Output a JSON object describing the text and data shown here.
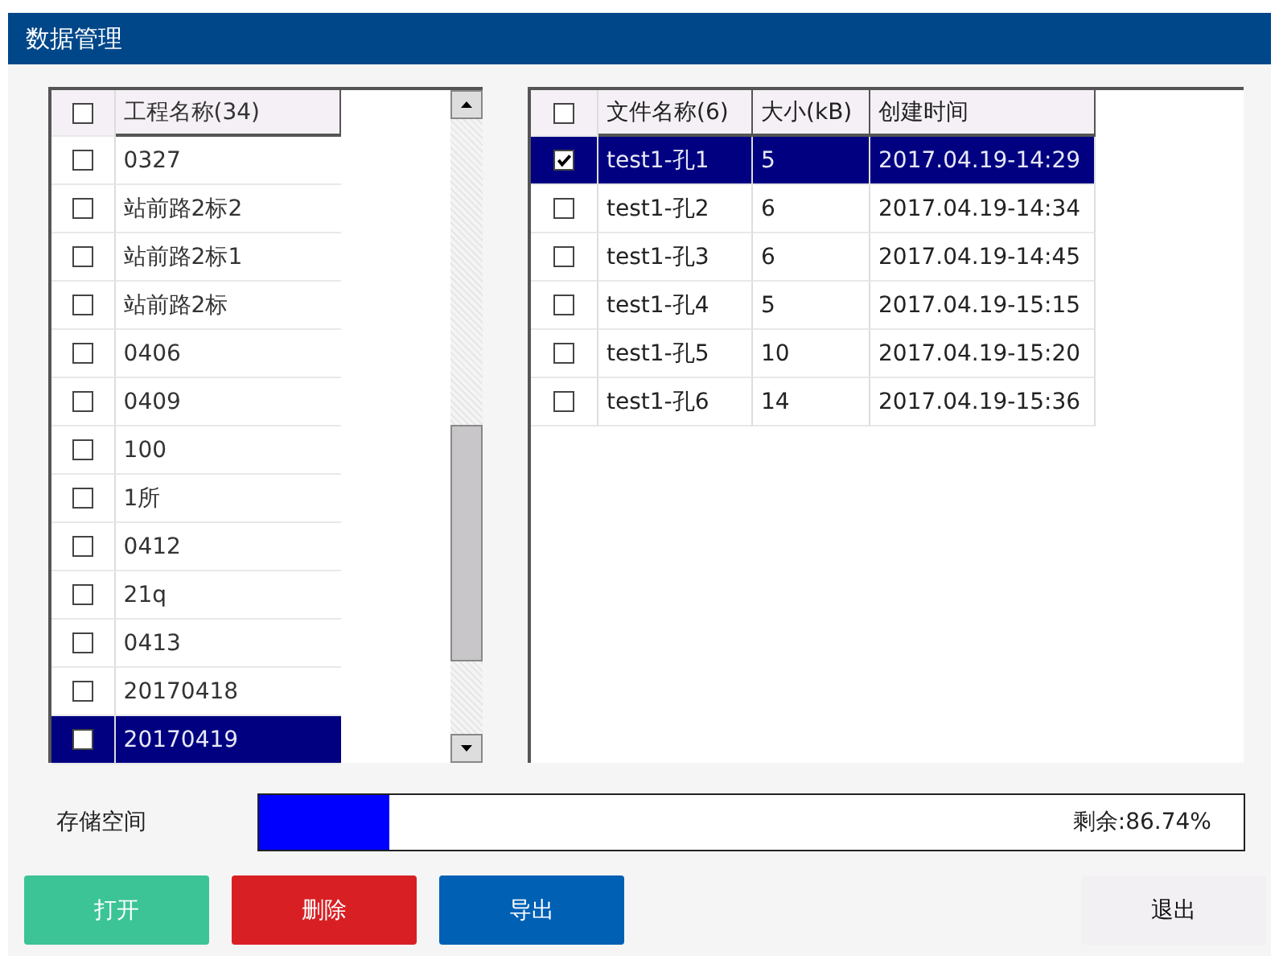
{
  "window": {
    "title": "数据管理"
  },
  "projects": {
    "header": "工程名称(34)",
    "header_checked": false,
    "rows": [
      {
        "name": "0327",
        "checked": false,
        "selected": false
      },
      {
        "name": "站前路2标2",
        "checked": false,
        "selected": false
      },
      {
        "name": "站前路2标1",
        "checked": false,
        "selected": false
      },
      {
        "name": "站前路2标",
        "checked": false,
        "selected": false
      },
      {
        "name": "0406",
        "checked": false,
        "selected": false
      },
      {
        "name": "0409",
        "checked": false,
        "selected": false
      },
      {
        "name": "100",
        "checked": false,
        "selected": false
      },
      {
        "name": "1所",
        "checked": false,
        "selected": false
      },
      {
        "name": "0412",
        "checked": false,
        "selected": false
      },
      {
        "name": "21q",
        "checked": false,
        "selected": false
      },
      {
        "name": "0413",
        "checked": false,
        "selected": false
      },
      {
        "name": "20170418",
        "checked": false,
        "selected": false
      },
      {
        "name": "20170419",
        "checked": false,
        "selected": true
      }
    ]
  },
  "files": {
    "header_checked": false,
    "columns": [
      "文件名称(6)",
      "大小(kB)",
      "创建时间"
    ],
    "rows": [
      {
        "cells": [
          "test1-孔1",
          "5",
          "2017.04.19-14:29"
        ],
        "checked": true,
        "selected": true
      },
      {
        "cells": [
          "test1-孔2",
          "6",
          "2017.04.19-14:34"
        ],
        "checked": false,
        "selected": false
      },
      {
        "cells": [
          "test1-孔3",
          "6",
          "2017.04.19-14:45"
        ],
        "checked": false,
        "selected": false
      },
      {
        "cells": [
          "test1-孔4",
          "5",
          "2017.04.19-15:15"
        ],
        "checked": false,
        "selected": false
      },
      {
        "cells": [
          "test1-孔5",
          "10",
          "2017.04.19-15:20"
        ],
        "checked": false,
        "selected": false
      },
      {
        "cells": [
          "test1-孔6",
          "14",
          "2017.04.19-15:36"
        ],
        "checked": false,
        "selected": false
      }
    ]
  },
  "storage": {
    "label": "存储空间",
    "level": 0.1326,
    "reading": "剩余:86.74%"
  },
  "buttons": [
    {
      "label": "打开",
      "kind": "open"
    },
    {
      "label": "删除",
      "kind": "delete"
    },
    {
      "label": "导出",
      "kind": "export"
    },
    {
      "label": "退出",
      "kind": "exit"
    }
  ]
}
